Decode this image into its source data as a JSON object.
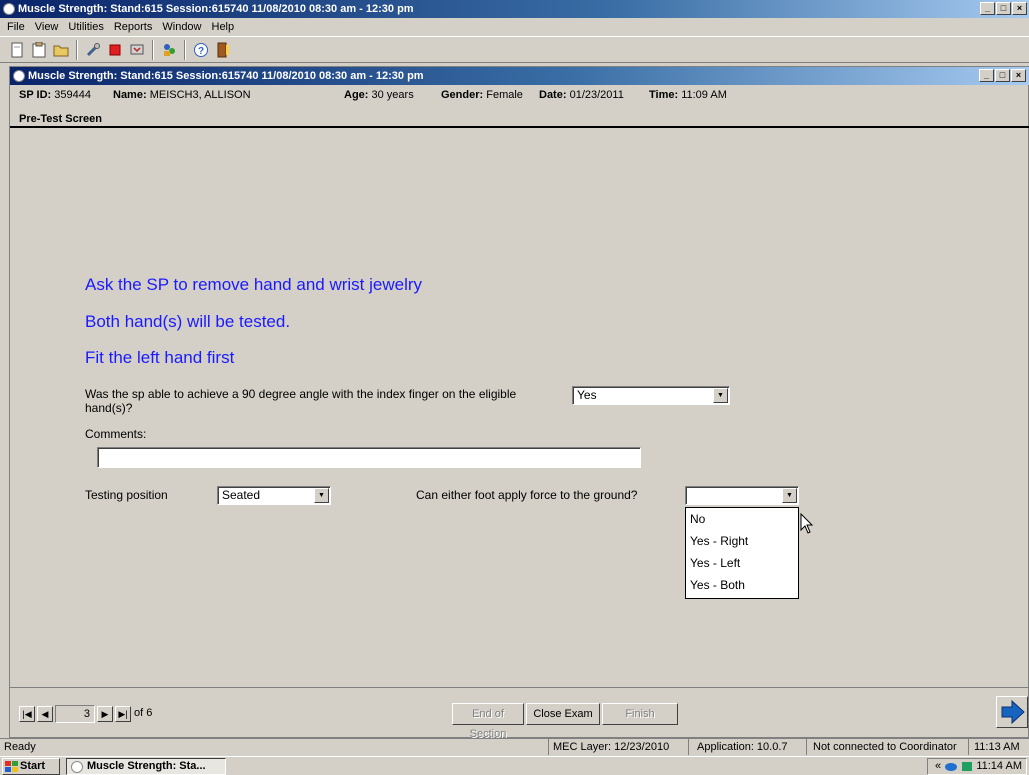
{
  "app": {
    "title": "Muscle Strength: Stand:615 Session:615740 11/08/2010 08:30 am - 12:30 pm",
    "window_buttons": [
      "_",
      "□",
      "×"
    ]
  },
  "menu": [
    "File",
    "View",
    "Utilities",
    "Reports",
    "Window",
    "Help"
  ],
  "toolbar": {
    "icons": [
      "new-document-icon",
      "clipboard-icon",
      "open-folder-icon",
      "tools-icon",
      "stop-icon",
      "transfer-icon",
      "people-icon",
      "help-icon",
      "exit-door-icon"
    ]
  },
  "child_window": {
    "title": "Muscle Strength: Stand:615 Session:615740 11/08/2010 08:30 am - 12:30 pm",
    "window_buttons": [
      "_",
      "□",
      "×"
    ]
  },
  "participant": {
    "sp_id_label": "SP ID:",
    "sp_id": "359444",
    "name_label": "Name:",
    "name": "MEISCH3, ALLISON",
    "age_label": "Age:",
    "age": "30 years",
    "gender_label": "Gender:",
    "gender": "Female",
    "date_label": "Date:",
    "date": "01/23/2011",
    "time_label": "Time:",
    "time": "11:09 AM"
  },
  "screen": {
    "header": "Pre-Test Screen",
    "instructions": [
      "Ask the SP to remove hand and wrist jewelry",
      "Both hand(s) will be tested.",
      "Fit the left hand first"
    ],
    "question_angle": "Was the sp able to achieve a 90 degree angle with the index finger on the eligible hand(s)?",
    "angle_value": "Yes",
    "comments_label": "Comments:",
    "comments_value": "",
    "testing_position_label": "Testing position",
    "testing_position_value": "Seated",
    "foot_question": "Can either foot apply force to the ground?",
    "foot_value": "",
    "foot_options": [
      "No",
      "Yes - Right",
      "Yes - Left",
      "Yes - Both"
    ]
  },
  "nav": {
    "page": "3",
    "of_label": "of 6",
    "end_of_section": "End of Section",
    "close_exam": "Close Exam",
    "finish": "Finish"
  },
  "status": {
    "ready": "Ready",
    "mec_layer": "MEC Layer: 12/23/2010",
    "application": "Application: 10.0.7",
    "coordinator": "Not connected to Coordinator",
    "time": "11:13 AM"
  },
  "taskbar": {
    "start": "Start",
    "task": "Muscle Strength: Sta...",
    "chevron": "«",
    "clock": "11:14 AM"
  },
  "colors": {
    "titlebar_start": "#0a246a",
    "instruction_blue": "#1a1aff",
    "next_arrow": "#1565c0"
  }
}
